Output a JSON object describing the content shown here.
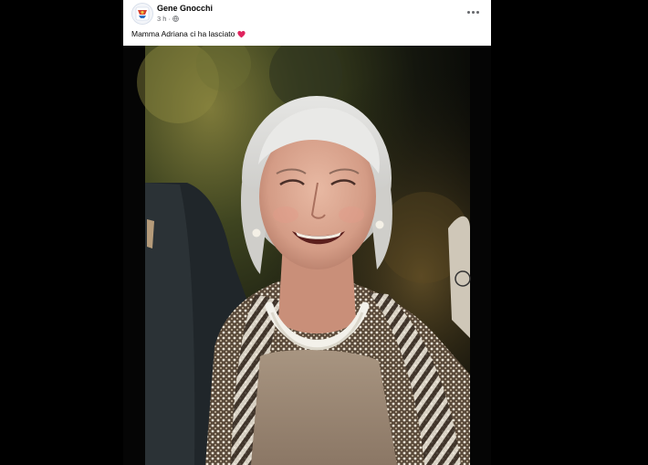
{
  "post": {
    "author": "Gene Gnocchi",
    "time": "3 h",
    "separator": "·",
    "caption": "Mamma Adriana ci ha lasciato",
    "caption_emoji_icon": "red-heart-icon",
    "privacy_icon": "globe-icon",
    "menu_icon": "more-options-icon",
    "photo_subject": "portrait-photo"
  },
  "colors": {
    "heart": "#e0245e",
    "meta_text": "#65676b",
    "background": "#000000"
  }
}
